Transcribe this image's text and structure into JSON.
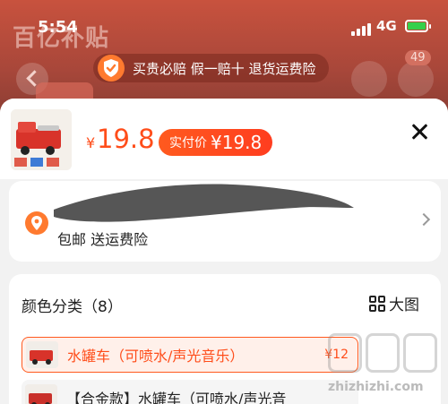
{
  "status_bar": {
    "time": "5:54",
    "network": "4G"
  },
  "background_page": {
    "banner": "百亿补贴",
    "badge_count": "49"
  },
  "guarantee": {
    "text": "买贵必赔 假一赔十 退货运费险"
  },
  "product": {
    "currency": "¥",
    "price": "19.8",
    "real_price_label": "实付价",
    "real_price_value": "¥19.8"
  },
  "shipping": {
    "text": "包邮  送运费险"
  },
  "variants": {
    "title": "颜色分类（8）",
    "view_big_image": "大图",
    "options": [
      {
        "label": "水罐车（可喷水/声光音乐）",
        "price": "¥12",
        "selected": true
      },
      {
        "label": "【合金款】水罐车（可喷水/声光音",
        "selected": false
      }
    ]
  },
  "watermark": "zhizhizhi.com",
  "colors": {
    "accent": "#ff4d1a",
    "selected_bg": "#fff0ea"
  }
}
